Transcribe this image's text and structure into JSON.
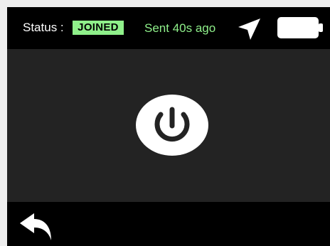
{
  "header": {
    "status_label": "Status :",
    "status_value": "JOINED",
    "last_sent": "Sent 40s ago",
    "nav_icon": "navigation-arrow-icon",
    "battery_icon": "battery-icon"
  },
  "main": {
    "power_icon": "power-icon"
  },
  "footer": {
    "back_icon": "back-arrow-icon"
  },
  "colors": {
    "topbar_bg": "#000000",
    "main_bg": "#232323",
    "accent_green": "#8ff08a",
    "outer_bg": "#eeeeee"
  }
}
